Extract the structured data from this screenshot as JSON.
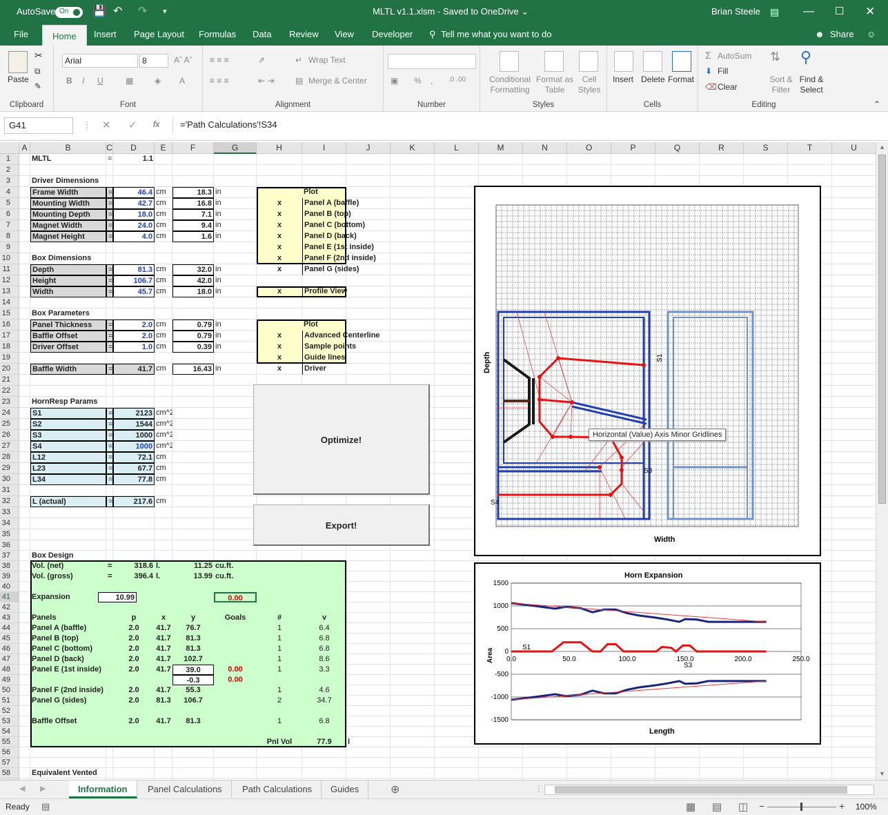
{
  "window": {
    "autosave": "AutoSave",
    "autosave_state": "On",
    "title": "MLTL v1.1.xlsm  -  Saved to OneDrive  ⌄",
    "user": "Brian Steele"
  },
  "menu": {
    "tabs": [
      "File",
      "Home",
      "Insert",
      "Page Layout",
      "Formulas",
      "Data",
      "Review",
      "View",
      "Developer"
    ],
    "tell_me": "Tell me what you want to do",
    "share": "Share"
  },
  "ribbon": {
    "clipboard": {
      "label": "Clipboard",
      "paste": "Paste"
    },
    "font": {
      "label": "Font",
      "name": "Arial",
      "size": "8"
    },
    "alignment": {
      "label": "Alignment",
      "wrap": "Wrap Text",
      "merge": "Merge & Center"
    },
    "number": {
      "label": "Number",
      "percent": "%",
      "comma": ","
    },
    "styles": {
      "label": "Styles",
      "conditional": "Conditional Formatting",
      "format_table": "Format as Table",
      "cell_styles": "Cell Styles"
    },
    "cells": {
      "label": "Cells",
      "insert": "Insert",
      "delete": "Delete",
      "format": "Format"
    },
    "editing": {
      "label": "Editing",
      "autosum": "AutoSum",
      "fill": "Fill",
      "clear": "Clear",
      "sort": "Sort & Filter",
      "find": "Find & Select"
    }
  },
  "formula": {
    "namebox": "G41",
    "fx": "fx",
    "content": "='Path Calculations'!S34"
  },
  "columns": [
    "A",
    "B",
    "C",
    "D",
    "E",
    "F",
    "G",
    "H",
    "I",
    "J",
    "K",
    "L",
    "M",
    "N",
    "O",
    "P",
    "Q",
    "R",
    "S",
    "T",
    "U"
  ],
  "rows": [
    "1",
    "2",
    "3",
    "4",
    "5",
    "6",
    "7",
    "8",
    "9",
    "10",
    "11",
    "12",
    "13",
    "14",
    "15",
    "16",
    "17",
    "18",
    "19",
    "20",
    "21",
    "22",
    "23",
    "24",
    "25",
    "26",
    "27",
    "28",
    "29",
    "30",
    "31",
    "32",
    "33",
    "34",
    "35",
    "36",
    "37",
    "38",
    "39",
    "40",
    "41",
    "42",
    "43",
    "44",
    "45",
    "46",
    "47",
    "48",
    "49",
    "50",
    "51",
    "52",
    "53",
    "54",
    "55",
    "56",
    "57",
    "58",
    "59"
  ],
  "sheet": {
    "mltl": "MLTL",
    "eq": "=",
    "version": "1.1",
    "driver_dims": "Driver Dimensions",
    "driver": [
      [
        "Frame Width",
        "46.4",
        "cm",
        "18.3",
        "in"
      ],
      [
        "Mounting Width",
        "42.7",
        "cm",
        "16.8",
        "in"
      ],
      [
        "Mounting Depth",
        "18.0",
        "cm",
        "7.1",
        "in"
      ],
      [
        "Magnet Width",
        "24.0",
        "cm",
        "9.4",
        "in"
      ],
      [
        "Magnet Height",
        "4.0",
        "cm",
        "1.6",
        "in"
      ]
    ],
    "box_dims": "Box Dimensions",
    "box": [
      [
        "Depth",
        "81.3",
        "cm",
        "32.0",
        "in"
      ],
      [
        "Height",
        "106.7",
        "cm",
        "42.0",
        "in"
      ],
      [
        "Width",
        "45.7",
        "cm",
        "18.0",
        "in"
      ]
    ],
    "box_params": "Box Parameters",
    "params": [
      [
        "Panel Thickness",
        "2.0",
        "cm",
        "0.79",
        "in"
      ],
      [
        "Baffle Offset",
        "2.0",
        "cm",
        "0.79",
        "in"
      ],
      [
        "Driver Offset",
        "1.0",
        "cm",
        "0.39",
        "in"
      ]
    ],
    "baffle": [
      "Baffle Width",
      "41.7",
      "cm",
      "16.43",
      "in"
    ],
    "hornresp": "HornResp Params",
    "horn": [
      [
        "S1",
        "2123",
        "cm^2"
      ],
      [
        "S2",
        "1544",
        "cm^2"
      ],
      [
        "S3",
        "1000",
        "cm^2"
      ],
      [
        "S4",
        "1000",
        "cm^2"
      ],
      [
        "L12",
        "72.1",
        "cm"
      ],
      [
        "L23",
        "67.7",
        "cm"
      ],
      [
        "L34",
        "77.8",
        "cm"
      ]
    ],
    "lactual": [
      "L (actual)",
      "217.6",
      "cm"
    ],
    "plot1_header": "Plot",
    "plot1": [
      [
        "x",
        "Panel A (baffle)"
      ],
      [
        "x",
        "Panel B (top)"
      ],
      [
        "x",
        "Panel C (bottom)"
      ],
      [
        "x",
        "Panel D (back)"
      ],
      [
        "x",
        "Panel E (1st inside)"
      ],
      [
        "x",
        "Panel F (2nd inside)"
      ],
      [
        "x",
        "Panel G (sides)"
      ]
    ],
    "profile": [
      "x",
      "Profile View"
    ],
    "plot2_header": "Plot",
    "plot2": [
      [
        "x",
        "Advanced Centerline"
      ],
      [
        "x",
        "Sample points"
      ],
      [
        "x",
        "Guide lines"
      ],
      [
        "x",
        "Driver"
      ]
    ],
    "optimize": "Optimize!",
    "export": "Export!",
    "box_design": "Box Design",
    "vol_net": [
      "Vol. (net)",
      "=",
      "318.6",
      "l.",
      "11.25",
      "cu.ft."
    ],
    "vol_gross": [
      "Vol. (gross)",
      "=",
      "396.4",
      "l.",
      "13.99",
      "cu.ft."
    ],
    "expansion": [
      "Expansion",
      "=",
      "10.99",
      "0.00"
    ],
    "panel_headers": [
      "Panels",
      "p",
      "x",
      "y",
      "Goals",
      "#",
      "v"
    ],
    "panels": [
      [
        "Panel A (baffle)",
        "2.0",
        "41.7",
        "76.7",
        "",
        "1",
        "6.4"
      ],
      [
        "Panel B (top)",
        "2.0",
        "41.7",
        "81.3",
        "",
        "1",
        "6.8"
      ],
      [
        "Panel C (bottom)",
        "2.0",
        "41.7",
        "81.3",
        "",
        "1",
        "6.8"
      ],
      [
        "Panel D (back)",
        "2.0",
        "41.7",
        "102.7",
        "",
        "1",
        "8.6"
      ],
      [
        "Panel E (1st inside)",
        "2.0",
        "41.7",
        "39.0",
        "0.00",
        "1",
        "3.3"
      ],
      [
        "",
        "",
        "",
        "-0.3",
        "0.00",
        "",
        ""
      ],
      [
        "Panel F (2nd inside)",
        "2.0",
        "41.7",
        "55.3",
        "",
        "1",
        "4.6"
      ],
      [
        "Panel G (sides)",
        "2.0",
        "81.3",
        "106.7",
        "",
        "2",
        "34.7"
      ],
      [
        "",
        "",
        "",
        "",
        "",
        "",
        ""
      ],
      [
        "Baffle Offset",
        "2.0",
        "41.7",
        "81.3",
        "",
        "1",
        "6.8"
      ]
    ],
    "pnlvol": [
      "Pnl Vol",
      "77.9",
      "l"
    ],
    "equiv": "Equivalent Vented"
  },
  "chart1": {
    "ylabel": "Depth",
    "xlabel": "Width",
    "tooltip": "Horizontal (Value) Axis Minor Gridlines",
    "labels": [
      "S1",
      "S3",
      "S4"
    ]
  },
  "chart2": {
    "title": "Horn Expansion",
    "ylabel": "Area",
    "xlabel": "Length",
    "yticks": [
      "1500",
      "1000",
      "500",
      "0",
      "-500",
      "-1000",
      "-1500"
    ],
    "xticks": [
      "0.0",
      "50.0",
      "100.0",
      "150.0",
      "200.0",
      "250.0"
    ],
    "s1": "S1",
    "s3": "S3"
  },
  "chart_data": {
    "type": "line",
    "title": "Horn Expansion",
    "xlabel": "Length",
    "ylabel": "Area",
    "xlim": [
      0,
      250
    ],
    "ylim": [
      -1500,
      1500
    ],
    "series": [
      {
        "values": [
          [
            0,
            1062
          ],
          [
            20,
            1000
          ],
          [
            38,
            940
          ],
          [
            47,
            980
          ],
          [
            60,
            950
          ],
          [
            70,
            860
          ],
          [
            80,
            920
          ],
          [
            90,
            920
          ],
          [
            100,
            840
          ],
          [
            110,
            790
          ],
          [
            125,
            740
          ],
          [
            135,
            700
          ],
          [
            145,
            650
          ],
          [
            150,
            710
          ],
          [
            160,
            700
          ],
          [
            170,
            650
          ],
          [
            200,
            650
          ],
          [
            220,
            650
          ]
        ]
      },
      {
        "values": [
          [
            0,
            1062
          ],
          [
            220,
            650
          ]
        ]
      },
      {
        "values": [
          [
            0,
            -1062
          ],
          [
            20,
            -1000
          ],
          [
            38,
            -940
          ],
          [
            47,
            -980
          ],
          [
            60,
            -950
          ],
          [
            70,
            -860
          ],
          [
            80,
            -920
          ],
          [
            90,
            -920
          ],
          [
            100,
            -840
          ],
          [
            110,
            -790
          ],
          [
            125,
            -740
          ],
          [
            135,
            -700
          ],
          [
            145,
            -650
          ],
          [
            150,
            -710
          ],
          [
            160,
            -700
          ],
          [
            170,
            -650
          ],
          [
            200,
            -650
          ],
          [
            220,
            -650
          ]
        ]
      },
      {
        "values": [
          [
            0,
            -1062
          ],
          [
            220,
            -650
          ]
        ]
      },
      {
        "values": [
          [
            0,
            0
          ],
          [
            35,
            0
          ],
          [
            45,
            200
          ],
          [
            60,
            200
          ],
          [
            70,
            0
          ],
          [
            77,
            0
          ],
          [
            83,
            160
          ],
          [
            90,
            160
          ],
          [
            97,
            0
          ],
          [
            125,
            0
          ],
          [
            130,
            100
          ],
          [
            138,
            80
          ],
          [
            142,
            0
          ],
          [
            148,
            130
          ],
          [
            154,
            130
          ],
          [
            160,
            0
          ],
          [
            220,
            0
          ]
        ]
      }
    ]
  },
  "sheet_tabs": [
    "Information",
    "Panel Calculations",
    "Path Calculations",
    "Guides"
  ],
  "status": {
    "ready": "Ready",
    "zoom": "100%"
  }
}
